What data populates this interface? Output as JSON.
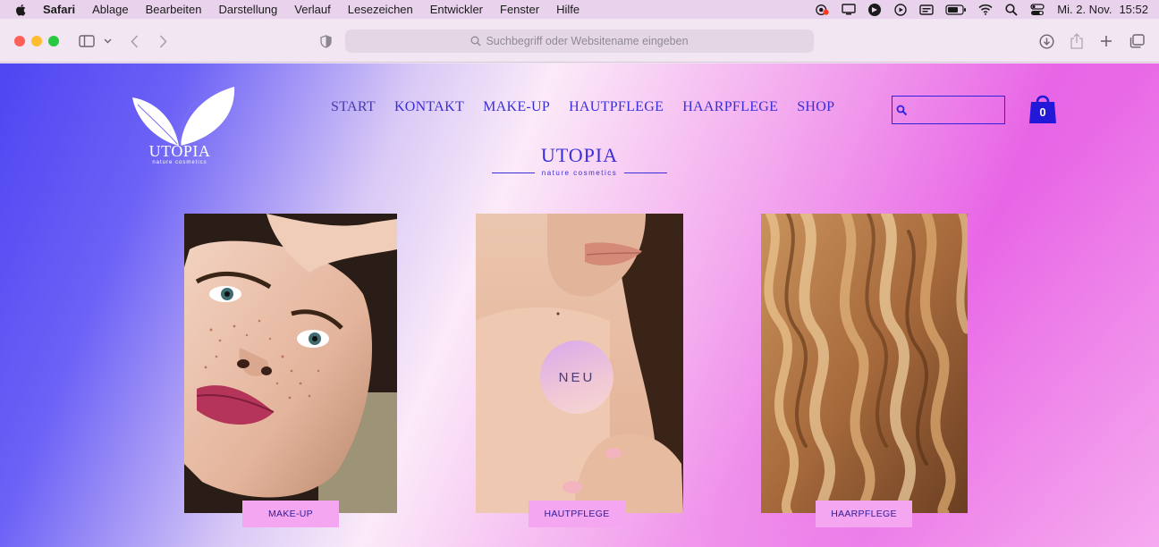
{
  "menubar": {
    "app_name": "Safari",
    "items": [
      "Ablage",
      "Bearbeiten",
      "Darstellung",
      "Verlauf",
      "Lesezeichen",
      "Entwickler",
      "Fenster",
      "Hilfe"
    ],
    "date": "Mi. 2. Nov.",
    "time": "15:52",
    "icons": [
      "apple-icon",
      "camera-recording-icon",
      "display-icon",
      "shield-app-icon",
      "play-icon",
      "keyboard-icon",
      "battery-icon",
      "wifi-icon",
      "search-icon",
      "control-center-icon"
    ]
  },
  "toolbar": {
    "address_placeholder": "Suchbegriff oder Websitename eingeben",
    "icons": [
      "sidebar-icon",
      "chevron-down-icon",
      "back-icon",
      "forward-icon",
      "privacy-shield-icon",
      "download-icon",
      "share-icon",
      "new-tab-icon",
      "tabs-overview-icon"
    ]
  },
  "site": {
    "logo": {
      "name": "UTOPIA",
      "tagline": "nature cosmetics"
    },
    "nav": [
      "START",
      "KONTAKT",
      "MAKE-UP",
      "HAUTPFLEGE",
      "HAARPFLEGE",
      "SHOP"
    ],
    "cart_count": "0",
    "brand": {
      "title": "UTOPIA",
      "subtitle": "nature cosmetics"
    },
    "cards": [
      {
        "label": "MAKE-UP",
        "image": "freckled-woman-portrait"
      },
      {
        "label": "HAUTPFLEGE",
        "image": "woman-shoulder",
        "badge": "NEU"
      },
      {
        "label": "HAARPFLEGE",
        "image": "wavy-hair"
      }
    ]
  },
  "colors": {
    "accent": "#3a2fd6",
    "button_bg": "#f5a6f0",
    "gradient_left": "#4f45f2",
    "gradient_right": "#e866e6"
  }
}
